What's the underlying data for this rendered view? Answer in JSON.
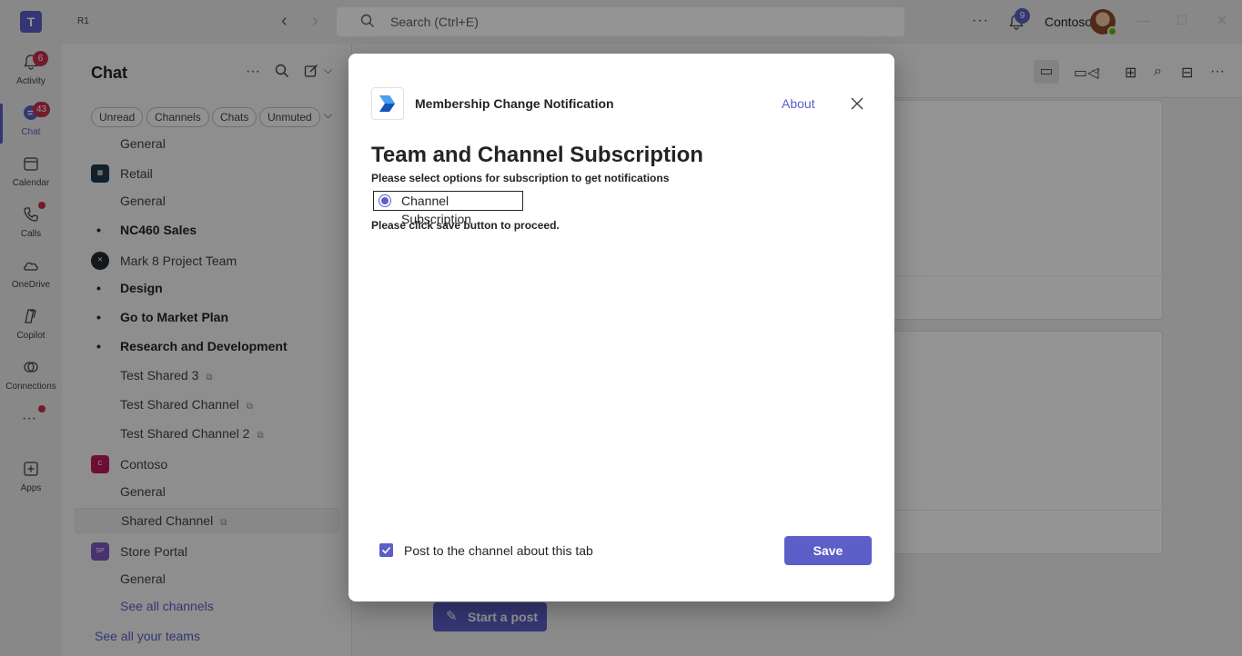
{
  "titlebar": {
    "tenant_label": "R1",
    "search_placeholder": "Search (Ctrl+E)",
    "notification_badge": "9",
    "org_name": "Contoso"
  },
  "rail": {
    "items": [
      {
        "label": "Activity",
        "badge": "6",
        "icon": "bell-icon"
      },
      {
        "label": "Chat",
        "badge": "43",
        "icon": "chat-icon",
        "active": true
      },
      {
        "label": "Calendar",
        "icon": "calendar-icon"
      },
      {
        "label": "Calls",
        "icon": "phone-icon"
      },
      {
        "label": "OneDrive",
        "icon": "cloud-icon"
      },
      {
        "label": "Copilot",
        "icon": "copilot-icon"
      },
      {
        "label": "Connections",
        "icon": "connections-icon"
      },
      {
        "label": "Apps",
        "icon": "add-square-icon"
      }
    ]
  },
  "chat_pane": {
    "title": "Chat",
    "filters": [
      "Unread",
      "Channels",
      "Chats",
      "Unmuted"
    ],
    "tree": [
      {
        "text": "General",
        "kind": "channel"
      },
      {
        "text": "Retail",
        "kind": "team"
      },
      {
        "text": "General",
        "kind": "channel"
      },
      {
        "text": "NC460 Sales",
        "kind": "unread"
      },
      {
        "text": "Mark 8 Project Team",
        "kind": "team"
      },
      {
        "text": "Design",
        "kind": "unread"
      },
      {
        "text": "Go to Market Plan",
        "kind": "unread"
      },
      {
        "text": "Research and Development",
        "kind": "unread"
      },
      {
        "text": "Test Shared 3",
        "kind": "shared"
      },
      {
        "text": "Test Shared Channel",
        "kind": "shared"
      },
      {
        "text": "Test Shared Channel 2",
        "kind": "shared"
      },
      {
        "text": "Contoso",
        "kind": "team",
        "avatar_text": "C"
      },
      {
        "text": "General",
        "kind": "channel"
      },
      {
        "text": "Shared Channel",
        "kind": "shared-selected"
      },
      {
        "text": "Store Portal",
        "kind": "team",
        "avatar_text": "SP"
      },
      {
        "text": "General",
        "kind": "channel"
      },
      {
        "text": "See all channels",
        "kind": "link"
      }
    ],
    "see_all_teams": "See all your teams"
  },
  "main": {
    "start_post_label": "Start a post"
  },
  "dialog": {
    "app_name": "Membership Change Notification",
    "about_label": "About",
    "heading": "Team and Channel Subscription",
    "subtitle": "Please select options for subscription to get notifications",
    "radio_label": "Channel Subscription",
    "radio_selected": true,
    "proceed_text": "Please click save button to proceed.",
    "post_checkbox_label": "Post to the channel about this tab",
    "post_checkbox_checked": true,
    "save_label": "Save"
  },
  "colors": {
    "accent": "#5b5fc7",
    "badge_red": "#c4314b",
    "overlay": "rgba(0,0,0,0.42)"
  }
}
